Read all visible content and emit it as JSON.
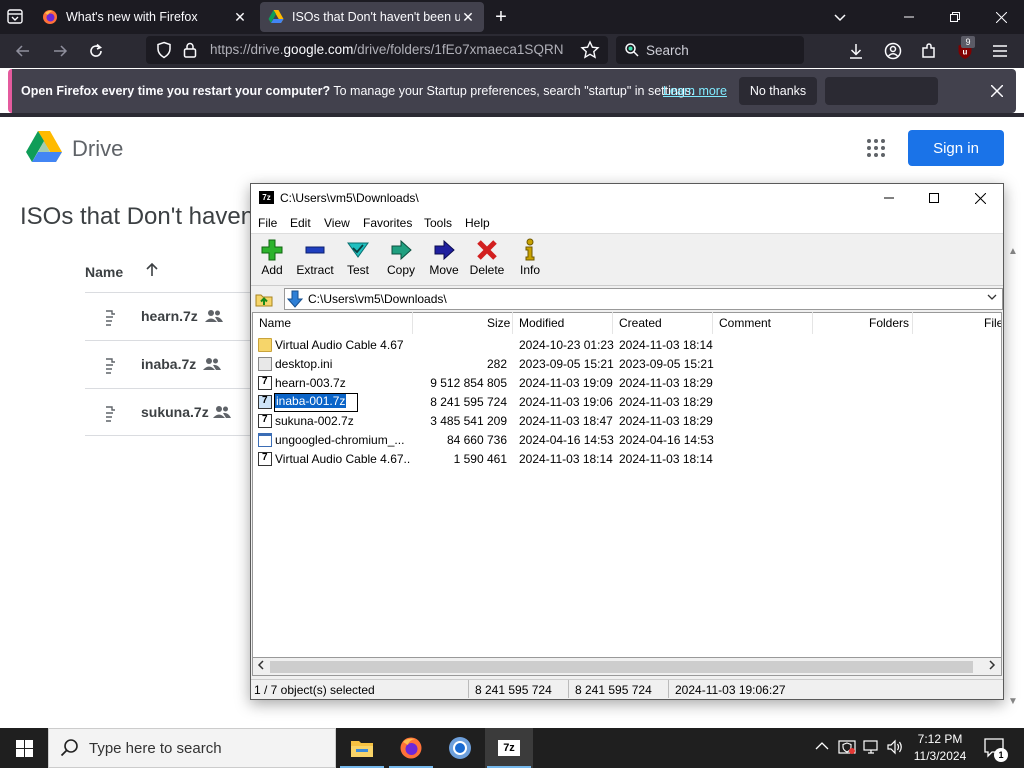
{
  "browser": {
    "tabs": [
      {
        "title": "What's new with Firefox"
      },
      {
        "title": "ISOs that Don't haven't been up"
      }
    ],
    "url_prefix": "https://drive.",
    "url_host": "google.com",
    "url_rest": "/drive/folders/1fEo7xmaeca1SQRN",
    "search_placeholder": "Search",
    "extension_badge": "9",
    "notification": {
      "bold_text": "Open Firefox every time you restart your computer?",
      "text": " To manage your Startup preferences, search \"startup\" in settings.",
      "link": "Learn more",
      "dismiss_label": "No thanks"
    }
  },
  "drive": {
    "brand": "Drive",
    "sign_in_label": "Sign in",
    "folder_title": "ISOs that Don't haven",
    "column_name": "Name",
    "files": [
      {
        "name": "hearn.7z"
      },
      {
        "name": "inaba.7z"
      },
      {
        "name": "sukuna.7z"
      }
    ]
  },
  "sevenzip": {
    "app_icon_text": "7z",
    "title": "C:\\Users\\vm5\\Downloads\\",
    "menu": [
      "File",
      "Edit",
      "View",
      "Favorites",
      "Tools",
      "Help"
    ],
    "toolbar": [
      {
        "label": "Add",
        "icon": "add-icon",
        "color": "#2db32d"
      },
      {
        "label": "Extract",
        "icon": "extract-icon",
        "color": "#1f3fbf"
      },
      {
        "label": "Test",
        "icon": "test-icon",
        "color": "#1fbfbf"
      },
      {
        "label": "Copy",
        "icon": "copy-icon",
        "color": "#1f9f7f"
      },
      {
        "label": "Move",
        "icon": "move-icon",
        "color": "#1f1f9f"
      },
      {
        "label": "Delete",
        "icon": "delete-icon",
        "color": "#d21f1f"
      },
      {
        "label": "Info",
        "icon": "info-icon",
        "color": "#c9a200"
      }
    ],
    "path": "C:\\Users\\vm5\\Downloads\\",
    "columns": [
      "Name",
      "Size",
      "Modified",
      "Created",
      "Comment",
      "Folders",
      "Files"
    ],
    "files": [
      {
        "name": "Virtual Audio Cable 4.67",
        "size": "",
        "modified": "2024-10-23 01:23",
        "created": "2024-11-03 18:14",
        "icon": "folder-icon"
      },
      {
        "name": "desktop.ini",
        "size": "282",
        "modified": "2023-09-05 15:21",
        "created": "2023-09-05 15:21",
        "icon": "ini-file-icon"
      },
      {
        "name": "hearn-003.7z",
        "size": "9 512 854 805",
        "modified": "2024-11-03 19:09",
        "created": "2024-11-03 18:29",
        "icon": "7z-file-icon"
      },
      {
        "name": "inaba-001.7z",
        "size": "8 241 595 724",
        "modified": "2024-11-03 19:06",
        "created": "2024-11-03 18:29",
        "icon": "7z-file-icon"
      },
      {
        "name": "sukuna-002.7z",
        "size": "3 485 541 209",
        "modified": "2024-11-03 18:47",
        "created": "2024-11-03 18:29",
        "icon": "7z-file-icon"
      },
      {
        "name": "ungoogled-chromium_...",
        "size": "84 660 736",
        "modified": "2024-04-16 14:53",
        "created": "2024-04-16 14:53",
        "icon": "exe-file-icon"
      },
      {
        "name": "Virtual Audio Cable 4.67...",
        "size": "1 590 461",
        "modified": "2024-11-03 18:14",
        "created": "2024-11-03 18:14",
        "icon": "7z-file-icon"
      }
    ],
    "editing_name": "inaba-001.7z",
    "status": {
      "selection": "1 / 7 object(s) selected",
      "size": "8 241 595 724",
      "packed": "8 241 595 724",
      "modified": "2024-11-03 19:06:27"
    }
  },
  "taskbar": {
    "search_placeholder": "Type here to search",
    "time": "7:12 PM",
    "date": "11/3/2024",
    "notification_count": "1",
    "app_7z_label": "7z"
  }
}
